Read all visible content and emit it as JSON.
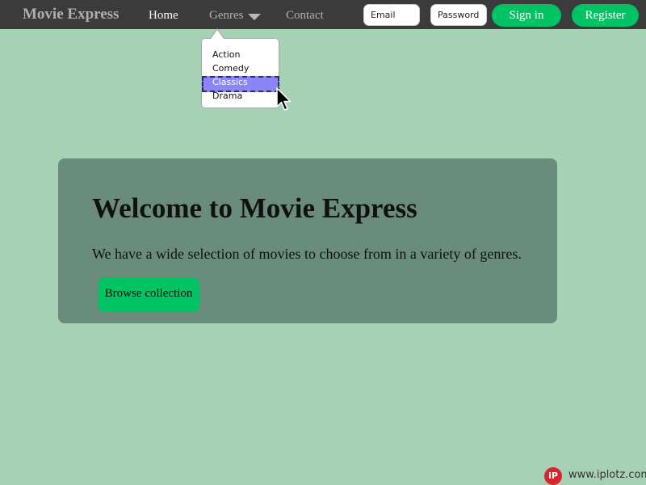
{
  "navbar": {
    "brand": "Movie Express",
    "items": [
      {
        "label": "Home"
      },
      {
        "label": "Genres"
      },
      {
        "label": "Contact"
      }
    ],
    "email_placeholder": "Email",
    "password_placeholder": "Password",
    "signin_label": "Sign in",
    "register_label": "Register"
  },
  "genres_menu": {
    "items": [
      "Action",
      "Comedy",
      "Classics",
      "Drama"
    ],
    "highlighted": "Classics"
  },
  "hero": {
    "title": "Welcome to Movie Express",
    "text": "We have a wide selection of movies to choose from in a variety of genres.",
    "button_label": "Browse collection"
  },
  "footer": {
    "badge_text": "iP",
    "site": "www.iplotz.com"
  },
  "colors": {
    "background": "#a7d1b4",
    "navbar": "#3b3b3b",
    "accent_green": "#00c464",
    "hero_panel": "#6a8c7d",
    "highlight": "#8b86f7"
  },
  "icons": {
    "genres_caret": "chevron-down-icon",
    "pointer": "mouse-cursor-icon",
    "brand_badge": "iplotz-logo-icon"
  }
}
